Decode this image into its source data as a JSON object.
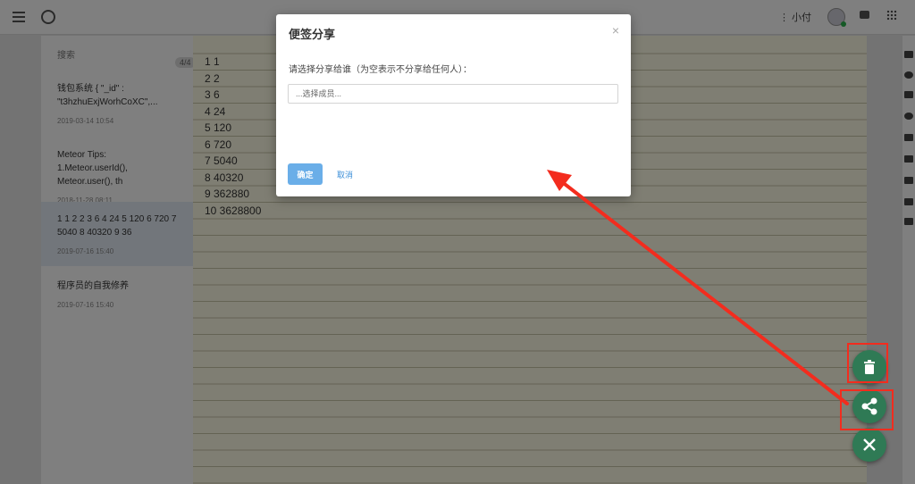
{
  "header": {
    "user_name": "⋮ 小付"
  },
  "sidebar": {
    "search_label": "搜索",
    "count": "4/4",
    "notes": [
      {
        "title": "钱包系统 { \"_id\" : \"t3hzhuExjWorhCoXC\",...",
        "date": "2019-03-14 10:54"
      },
      {
        "title": "Meteor Tips: 1.Meteor.userId(), Meteor.user(), th",
        "date": "2018-11-28 08:11"
      },
      {
        "title": "1 1 2 2 3 6 4 24 5 120 6 720 7 5040 8 40320 9 36",
        "date": "2019-07-16 15:40"
      },
      {
        "title": "程序员的自我修养",
        "date": "2019-07-16 15:40"
      }
    ]
  },
  "editor": {
    "lines": [
      "1 1",
      "2 2",
      "3 6",
      "4 24",
      "5 120",
      "6 720",
      "7 5040",
      "8 40320",
      "9 362880",
      "10 3628800"
    ]
  },
  "modal": {
    "title": "便签分享",
    "close_glyph": "×",
    "label": "请选择分享给谁（为空表示不分享给任何人）：",
    "input_placeholder": "...选择成员...",
    "confirm_label": "确定",
    "cancel_label": "取消"
  },
  "fabs": {
    "delete_icon": "trash-icon",
    "share_icon": "share-icon",
    "close_icon": "close-icon",
    "color": "#2f7a55"
  },
  "annotation": {
    "color": "#f32c1e"
  }
}
